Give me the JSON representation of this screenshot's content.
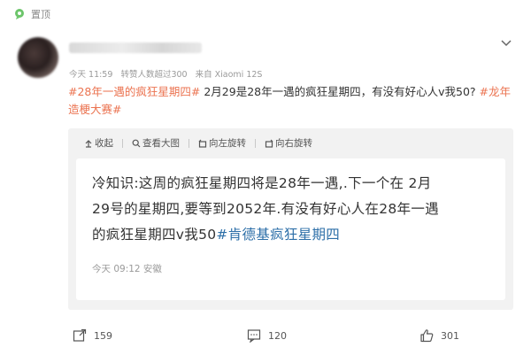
{
  "pin": {
    "label": "置顶"
  },
  "post": {
    "meta": {
      "time": "今天 11:59",
      "likes_info": "转赞人数超过300",
      "source": "来自 Xiaomi 12S"
    },
    "text": {
      "tag1": "#28年一遇的疯狂星期四#",
      "body": " 2月29是28年一遇的疯狂星期四，有没有好心人v我50? ",
      "tag2": "#龙年造梗大赛#"
    }
  },
  "repost": {
    "toolbar": {
      "collapse": "收起",
      "view_large": "查看大图",
      "rotate_left": "向左旋转",
      "rotate_right": "向右旋转"
    },
    "inner": {
      "line1": "冷知识:这周的疯狂星期四将是28年一遇,.下一个在 2月",
      "line2": "29号的星期四,要等到2052年.有没有好心人在28年一遇",
      "line3_text": "的疯狂星期四v我50",
      "line3_tag": "#肯德基疯狂星期四",
      "meta": "今天 09:12 安徽"
    }
  },
  "actions": {
    "repost_count": "159",
    "comment_count": "120",
    "like_count": "301"
  },
  "colors": {
    "hashtag": "#eb7350",
    "inner_hashtag": "#2d6fa8",
    "repost_bg": "#f2f2f2"
  }
}
